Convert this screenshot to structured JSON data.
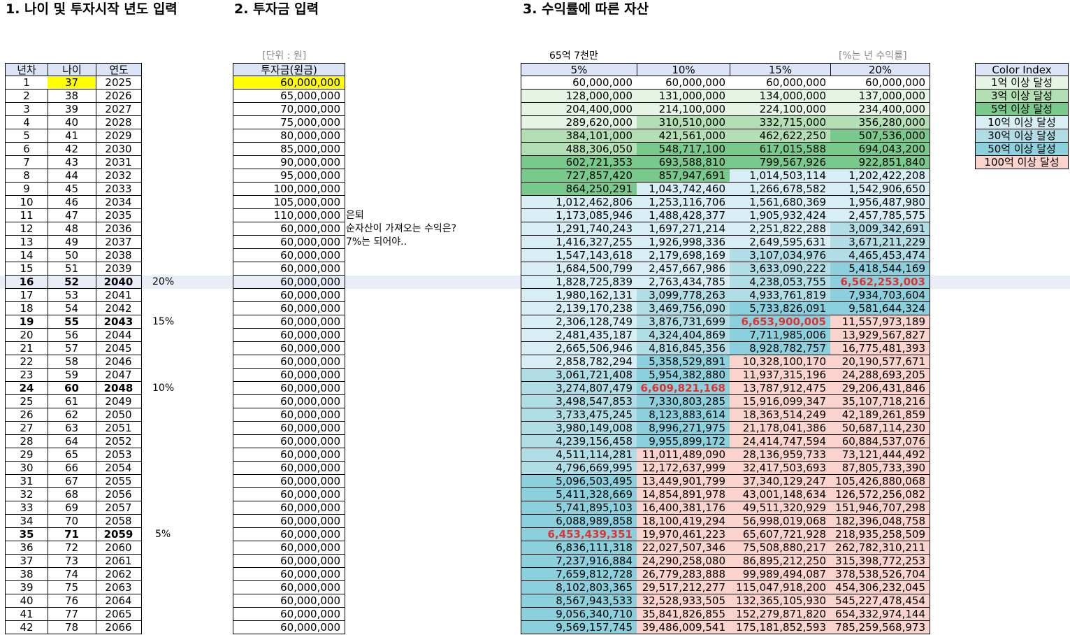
{
  "titles": {
    "t1": "1. 나이 및 투자시작 년도 입력",
    "t2": "2. 투자금 입력",
    "t3": "3. 수익률에 따른 자산"
  },
  "notes": {
    "unit": "[단위 : 원]",
    "target": "65억 7천만",
    "rate_unit": "[%는 년 수익률]",
    "retire": "은퇴",
    "question": "순자산이 가져오는 수익은?",
    "answer": "7%는 되어야.."
  },
  "headers": {
    "year_no": "년차",
    "age": "나이",
    "year": "연도",
    "principal": "투자금(원금)",
    "r5": "5%",
    "r10": "10%",
    "r15": "15%",
    "r20": "20%"
  },
  "legend": {
    "title": "Color Index",
    "items": [
      {
        "label": "1억 이상 달성",
        "color": "#e6f4e6"
      },
      {
        "label": "3억 이상 달성",
        "color": "#b4dfb4"
      },
      {
        "label": "5억 이상 달성",
        "color": "#79c98c"
      },
      {
        "label": "10억 이상 달성",
        "color": "#d7eff4"
      },
      {
        "label": "30억 이상 달성",
        "color": "#b0dde6"
      },
      {
        "label": "50억 이상 달성",
        "color": "#8bd0dc"
      },
      {
        "label": "100억 이상 달성",
        "color": "#f9d3cc"
      }
    ]
  },
  "colors": {
    "c0": "#ffffff",
    "c1": "#e6f4e6",
    "c3": "#b4dfb4",
    "c5": "#79c98c",
    "c10": "#d7eff4",
    "c30": "#b0dde6",
    "c50": "#8bd0dc",
    "c100": "#f9d3cc",
    "header_bg": "#dbe5f5",
    "input_highlight": "#ffff00",
    "target_red": "#e03232"
  },
  "rows": [
    {
      "n": "1",
      "age": "37",
      "year": "2025",
      "p": "60,000,000",
      "v": [
        "60,000,000",
        "60,000,000",
        "60,000,000",
        "60,000,000"
      ]
    },
    {
      "n": "2",
      "age": "38",
      "year": "2026",
      "p": "65,000,000",
      "v": [
        "128,000,000",
        "131,000,000",
        "134,000,000",
        "137,000,000"
      ]
    },
    {
      "n": "3",
      "age": "39",
      "year": "2027",
      "p": "70,000,000",
      "v": [
        "204,400,000",
        "214,100,000",
        "224,100,000",
        "234,400,000"
      ]
    },
    {
      "n": "4",
      "age": "40",
      "year": "2028",
      "p": "75,000,000",
      "v": [
        "289,620,000",
        "310,510,000",
        "332,715,000",
        "356,280,000"
      ]
    },
    {
      "n": "5",
      "age": "41",
      "year": "2029",
      "p": "80,000,000",
      "v": [
        "384,101,000",
        "421,561,000",
        "462,622,250",
        "507,536,000"
      ]
    },
    {
      "n": "6",
      "age": "42",
      "year": "2030",
      "p": "85,000,000",
      "v": [
        "488,306,050",
        "548,717,100",
        "617,015,588",
        "694,043,200"
      ]
    },
    {
      "n": "7",
      "age": "43",
      "year": "2031",
      "p": "90,000,000",
      "v": [
        "602,721,353",
        "693,588,810",
        "799,567,926",
        "922,851,840"
      ]
    },
    {
      "n": "8",
      "age": "44",
      "year": "2032",
      "p": "95,000,000",
      "v": [
        "727,857,420",
        "857,947,691",
        "1,014,503,114",
        "1,202,422,208"
      ]
    },
    {
      "n": "9",
      "age": "45",
      "year": "2033",
      "p": "100,000,000",
      "v": [
        "864,250,291",
        "1,043,742,460",
        "1,266,678,582",
        "1,542,906,650"
      ]
    },
    {
      "n": "10",
      "age": "46",
      "year": "2034",
      "p": "105,000,000",
      "v": [
        "1,012,462,806",
        "1,253,116,706",
        "1,561,680,369",
        "1,956,487,980"
      ]
    },
    {
      "n": "11",
      "age": "47",
      "year": "2035",
      "p": "110,000,000",
      "v": [
        "1,173,085,946",
        "1,488,428,377",
        "1,905,932,424",
        "2,457,785,575"
      ]
    },
    {
      "n": "12",
      "age": "48",
      "year": "2036",
      "p": "60,000,000",
      "v": [
        "1,291,740,243",
        "1,697,271,214",
        "2,251,822,288",
        "3,009,342,691"
      ]
    },
    {
      "n": "13",
      "age": "49",
      "year": "2037",
      "p": "60,000,000",
      "v": [
        "1,416,327,255",
        "1,926,998,336",
        "2,649,595,631",
        "3,671,211,229"
      ]
    },
    {
      "n": "14",
      "age": "50",
      "year": "2038",
      "p": "60,000,000",
      "v": [
        "1,547,143,618",
        "2,179,698,169",
        "3,107,034,976",
        "4,465,453,474"
      ]
    },
    {
      "n": "15",
      "age": "51",
      "year": "2039",
      "p": "60,000,000",
      "v": [
        "1,684,500,799",
        "2,457,667,986",
        "3,633,090,222",
        "5,418,544,169"
      ]
    },
    {
      "n": "16",
      "age": "52",
      "year": "2040",
      "p": "60,000,000",
      "mark": "20%",
      "v": [
        "1,828,725,839",
        "2,763,434,785",
        "4,238,053,755",
        "6,562,253,003"
      ]
    },
    {
      "n": "17",
      "age": "53",
      "year": "2041",
      "p": "60,000,000",
      "v": [
        "1,980,162,131",
        "3,099,778,263",
        "4,933,761,819",
        "7,934,703,604"
      ]
    },
    {
      "n": "18",
      "age": "54",
      "year": "2042",
      "p": "60,000,000",
      "v": [
        "2,139,170,238",
        "3,469,756,090",
        "5,733,826,091",
        "9,581,644,324"
      ]
    },
    {
      "n": "19",
      "age": "55",
      "year": "2043",
      "p": "60,000,000",
      "mark": "15%",
      "v": [
        "2,306,128,749",
        "3,876,731,699",
        "6,653,900,005",
        "11,557,973,189"
      ]
    },
    {
      "n": "20",
      "age": "56",
      "year": "2044",
      "p": "60,000,000",
      "v": [
        "2,481,435,187",
        "4,324,404,869",
        "7,711,985,006",
        "13,929,567,827"
      ]
    },
    {
      "n": "21",
      "age": "57",
      "year": "2045",
      "p": "60,000,000",
      "v": [
        "2,665,506,946",
        "4,816,845,356",
        "8,928,782,757",
        "16,775,481,393"
      ]
    },
    {
      "n": "22",
      "age": "58",
      "year": "2046",
      "p": "60,000,000",
      "v": [
        "2,858,782,294",
        "5,358,529,891",
        "10,328,100,170",
        "20,190,577,671"
      ]
    },
    {
      "n": "23",
      "age": "59",
      "year": "2047",
      "p": "60,000,000",
      "v": [
        "3,061,721,408",
        "5,954,382,880",
        "11,937,315,196",
        "24,288,693,205"
      ]
    },
    {
      "n": "24",
      "age": "60",
      "year": "2048",
      "p": "60,000,000",
      "mark": "10%",
      "v": [
        "3,274,807,479",
        "6,609,821,168",
        "13,787,912,475",
        "29,206,431,846"
      ]
    },
    {
      "n": "25",
      "age": "61",
      "year": "2049",
      "p": "60,000,000",
      "v": [
        "3,498,547,853",
        "7,330,803,285",
        "15,916,099,347",
        "35,107,718,216"
      ]
    },
    {
      "n": "26",
      "age": "62",
      "year": "2050",
      "p": "60,000,000",
      "v": [
        "3,733,475,245",
        "8,123,883,614",
        "18,363,514,249",
        "42,189,261,859"
      ]
    },
    {
      "n": "27",
      "age": "63",
      "year": "2051",
      "p": "60,000,000",
      "v": [
        "3,980,149,008",
        "8,996,271,975",
        "21,178,041,386",
        "50,687,114,230"
      ]
    },
    {
      "n": "28",
      "age": "64",
      "year": "2052",
      "p": "60,000,000",
      "v": [
        "4,239,156,458",
        "9,955,899,172",
        "24,414,747,594",
        "60,884,537,076"
      ]
    },
    {
      "n": "29",
      "age": "65",
      "year": "2053",
      "p": "60,000,000",
      "v": [
        "4,511,114,281",
        "11,011,489,090",
        "28,136,959,733",
        "73,121,444,492"
      ]
    },
    {
      "n": "30",
      "age": "66",
      "year": "2054",
      "p": "60,000,000",
      "v": [
        "4,796,669,995",
        "12,172,637,999",
        "32,417,503,693",
        "87,805,733,390"
      ]
    },
    {
      "n": "31",
      "age": "67",
      "year": "2055",
      "p": "60,000,000",
      "v": [
        "5,096,503,495",
        "13,449,901,799",
        "37,340,129,247",
        "105,426,880,068"
      ]
    },
    {
      "n": "32",
      "age": "68",
      "year": "2056",
      "p": "60,000,000",
      "v": [
        "5,411,328,669",
        "14,854,891,978",
        "43,001,148,634",
        "126,572,256,082"
      ]
    },
    {
      "n": "33",
      "age": "69",
      "year": "2057",
      "p": "60,000,000",
      "v": [
        "5,741,895,103",
        "16,400,381,176",
        "49,511,320,929",
        "151,946,707,298"
      ]
    },
    {
      "n": "34",
      "age": "70",
      "year": "2058",
      "p": "60,000,000",
      "v": [
        "6,088,989,858",
        "18,100,419,294",
        "56,998,019,068",
        "182,396,048,758"
      ]
    },
    {
      "n": "35",
      "age": "71",
      "year": "2059",
      "p": "60,000,000",
      "mark": "5%",
      "v": [
        "6,453,439,351",
        "19,970,461,223",
        "65,607,721,928",
        "218,935,258,509"
      ]
    },
    {
      "n": "36",
      "age": "72",
      "year": "2060",
      "p": "60,000,000",
      "v": [
        "6,836,111,318",
        "22,027,507,346",
        "75,508,880,217",
        "262,782,310,211"
      ]
    },
    {
      "n": "37",
      "age": "73",
      "year": "2061",
      "p": "60,000,000",
      "v": [
        "7,237,916,884",
        "24,290,258,080",
        "86,895,212,250",
        "315,398,772,253"
      ]
    },
    {
      "n": "38",
      "age": "74",
      "year": "2062",
      "p": "60,000,000",
      "v": [
        "7,659,812,728",
        "26,779,283,888",
        "99,989,494,087",
        "378,538,526,704"
      ]
    },
    {
      "n": "39",
      "age": "75",
      "year": "2063",
      "p": "60,000,000",
      "v": [
        "8,102,803,365",
        "29,517,212,277",
        "115,047,918,200",
        "454,306,232,045"
      ]
    },
    {
      "n": "40",
      "age": "76",
      "year": "2064",
      "p": "60,000,000",
      "v": [
        "8,567,943,533",
        "32,528,933,505",
        "132,365,105,930",
        "545,227,478,454"
      ]
    },
    {
      "n": "41",
      "age": "77",
      "year": "2065",
      "p": "60,000,000",
      "v": [
        "9,056,340,710",
        "35,841,826,855",
        "152,279,871,820",
        "654,332,974,144"
      ]
    },
    {
      "n": "42",
      "age": "78",
      "year": "2066",
      "p": "60,000,000",
      "v": [
        "9,569,157,745",
        "39,486,009,541",
        "175,181,852,593",
        "785,259,568,973"
      ]
    }
  ]
}
